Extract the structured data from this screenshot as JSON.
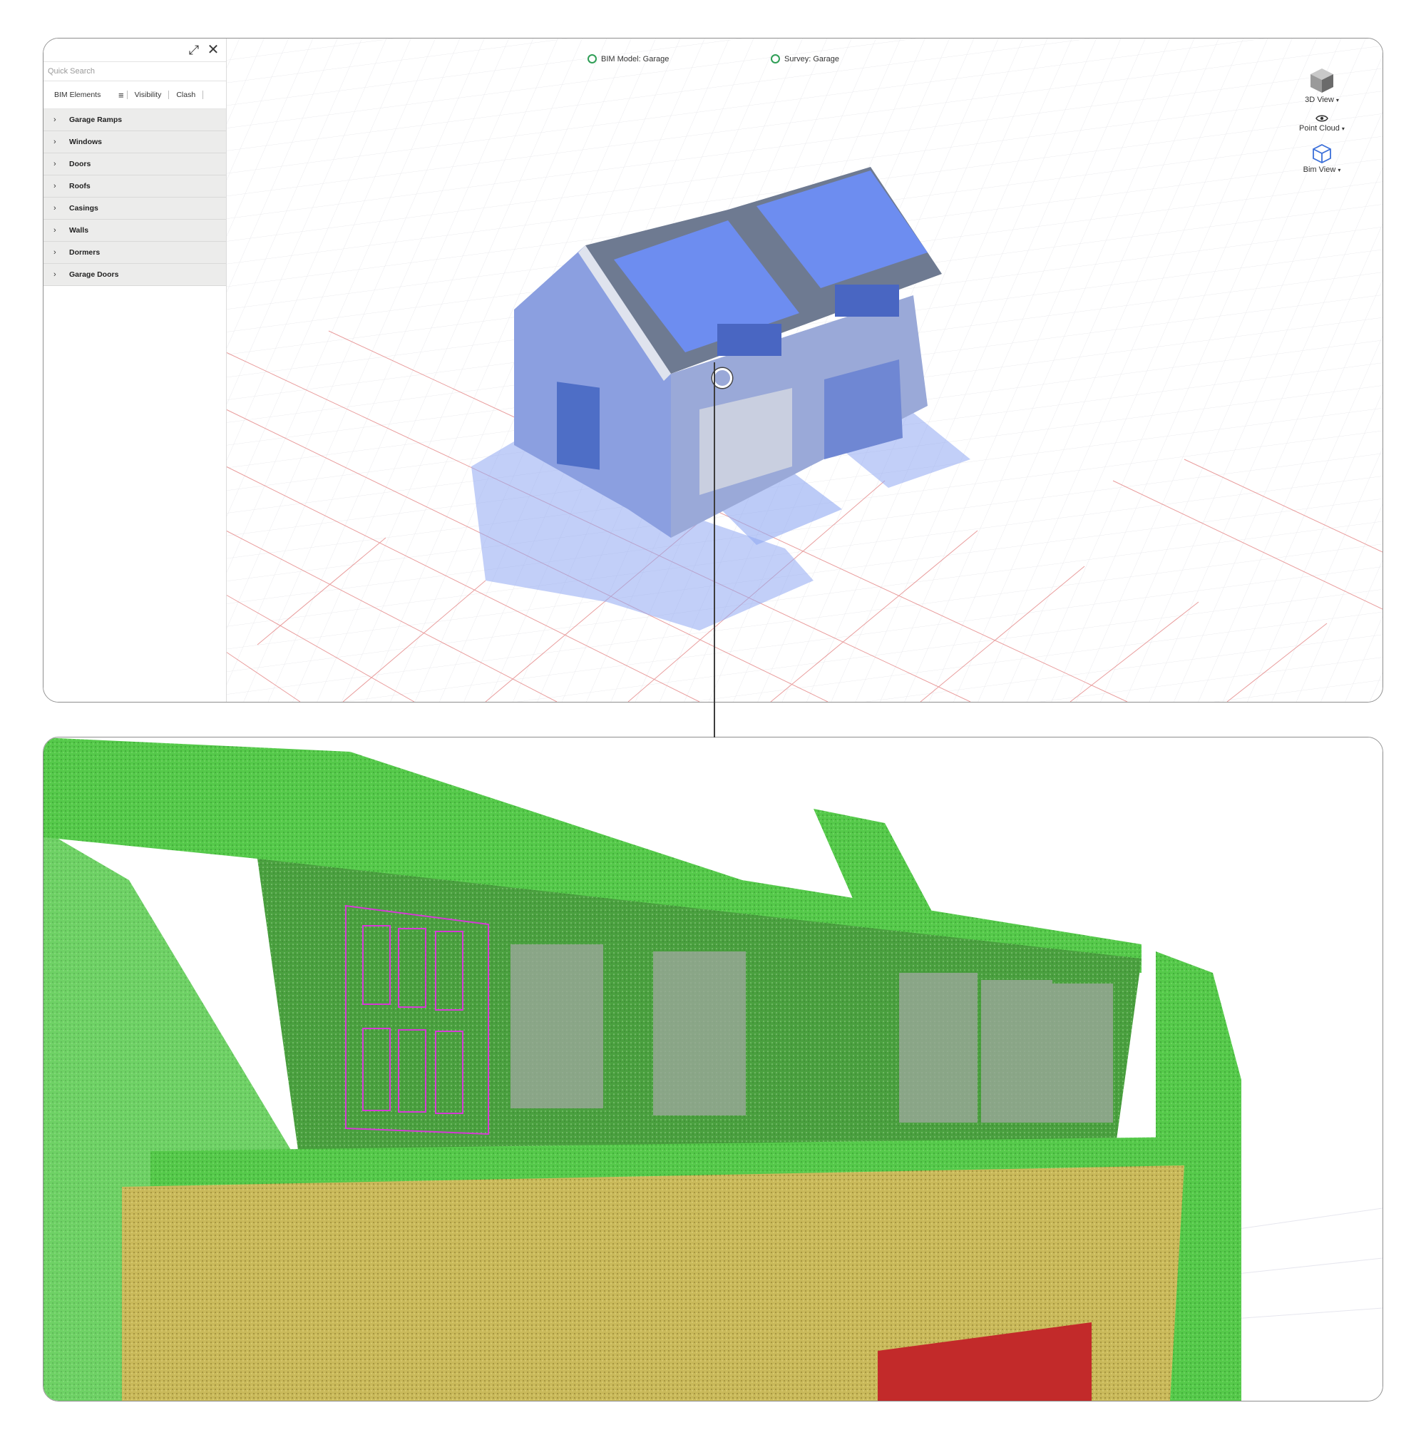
{
  "sidebar": {
    "search_placeholder": "Quick Search",
    "tabs": [
      "BIM Elements",
      "Visibility",
      "Clash"
    ],
    "categories": [
      "Garage Ramps",
      "Windows",
      "Doors",
      "Roofs",
      "Casings",
      "Walls",
      "Dormers",
      "Garage Doors"
    ]
  },
  "header": {
    "bim_model": "BIM Model: Garage",
    "survey": "Survey: Garage",
    "status_color": "#2f9e56"
  },
  "view_tools": {
    "view_3d": "3D View",
    "point_cloud": "Point Cloud",
    "bim_view": "Bim View"
  },
  "icons": {
    "expand": "expand-icon",
    "close": "close-icon",
    "filter": "filter-icon",
    "cube": "cube-icon",
    "eye": "eye-icon",
    "bim_cube": "bim-cube-icon"
  },
  "colors": {
    "bim_overlay": "#6f8fe6",
    "point_cloud_green": "#55c94a",
    "point_cloud_yellow": "#c9b95a",
    "point_cloud_red": "#c22a2a",
    "grid_red": "#e06b6b",
    "selection_magenta": "#d63ad6"
  }
}
